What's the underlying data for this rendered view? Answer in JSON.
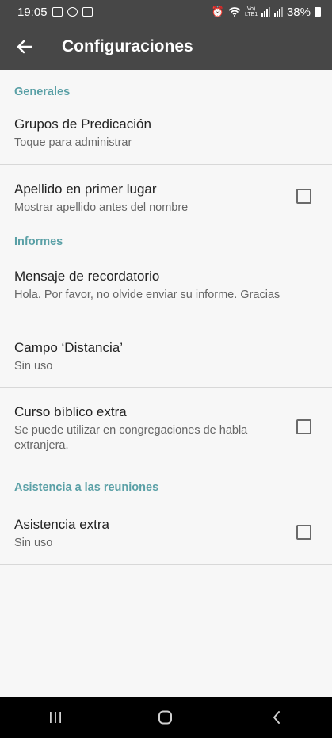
{
  "status_bar": {
    "time": "19:05",
    "network_label": "Vo) LTE1",
    "battery": "38%"
  },
  "app_bar": {
    "title": "Configuraciones",
    "back_icon": "arrow-left-icon"
  },
  "sections": [
    {
      "header": "Generales",
      "items": [
        {
          "title": "Grupos de Predicación",
          "subtitle": "Toque para administrar"
        },
        {
          "title": "Apellido en primer lugar",
          "subtitle": "Mostrar apellido antes del nombre",
          "checked": false
        }
      ]
    },
    {
      "header": "Informes",
      "items": [
        {
          "title": "Mensaje de recordatorio",
          "subtitle": "Hola. Por favor, no olvide enviar su informe. Gracias"
        },
        {
          "title": "Campo ‘Distancia’",
          "subtitle": "Sin uso"
        },
        {
          "title": "Curso bíblico extra",
          "subtitle": "Se puede utilizar en congregaciones de habla extranjera.",
          "checked": false
        }
      ]
    },
    {
      "header": "Asistencia a las reuniones",
      "items": [
        {
          "title": "Asistencia extra",
          "subtitle": "Sin uso",
          "checked": false
        }
      ]
    }
  ],
  "nav_bar": {
    "icons": [
      "recent-apps-icon",
      "home-icon",
      "back-icon"
    ]
  },
  "colors": {
    "app_bar": "#474747",
    "section_header": "#5aa0a6",
    "background": "#f7f7f7"
  }
}
